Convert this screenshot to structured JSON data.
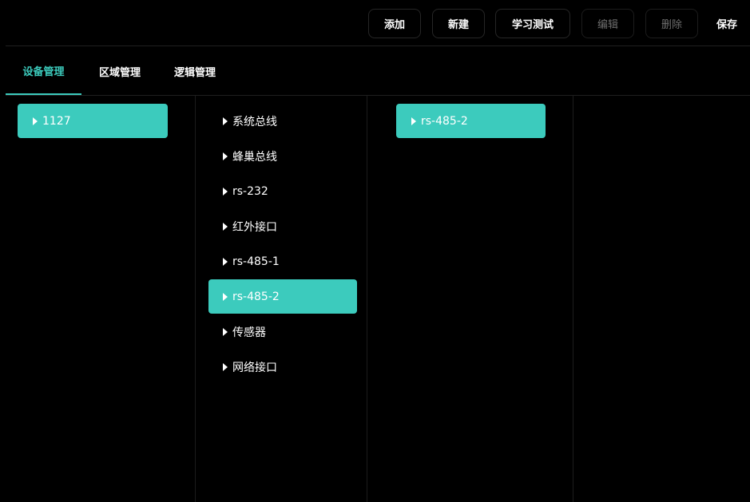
{
  "toolbar": {
    "add_label": "添加",
    "new_label": "新建",
    "learn_test_label": "学习测试",
    "edit_label": "编辑",
    "delete_label": "删除",
    "save_label": "保存"
  },
  "tabs": [
    {
      "label": "设备管理",
      "active": true
    },
    {
      "label": "区域管理",
      "active": false
    },
    {
      "label": "逻辑管理",
      "active": false
    }
  ],
  "columns": {
    "devices": [
      {
        "label": "1127",
        "selected": true
      }
    ],
    "interfaces": [
      {
        "label": "系统总线",
        "selected": false
      },
      {
        "label": "蜂巢总线",
        "selected": false
      },
      {
        "label": "rs-232",
        "selected": false
      },
      {
        "label": "红外接口",
        "selected": false
      },
      {
        "label": "rs-485-1",
        "selected": false
      },
      {
        "label": "rs-485-2",
        "selected": true
      },
      {
        "label": "传感器",
        "selected": false
      },
      {
        "label": "网络接口",
        "selected": false
      }
    ],
    "selected_interface": [
      {
        "label": "rs-485-2",
        "selected": true
      }
    ]
  },
  "colors": {
    "accent": "#3ccbbd",
    "background": "#000000",
    "text": "#ffffff",
    "disabled_text": "#6e6e6e"
  },
  "icons": {
    "item_marker": "caret-right-icon"
  }
}
